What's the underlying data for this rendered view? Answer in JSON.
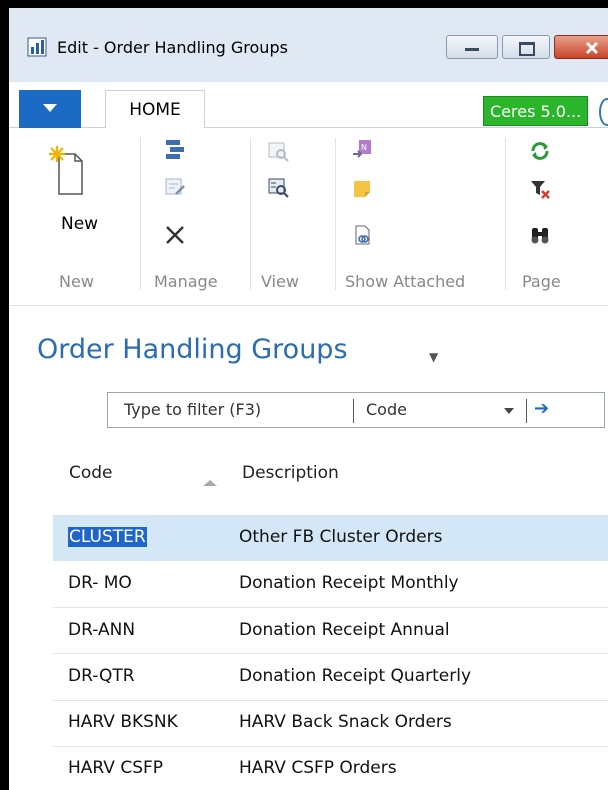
{
  "window": {
    "title": "Edit - Order Handling Groups"
  },
  "tabs": {
    "home": "HOME",
    "version": "Ceres 5.0..."
  },
  "ribbon": {
    "new_label": "New",
    "groups": [
      "New",
      "Manage",
      "View",
      "Show Attached",
      "Page"
    ]
  },
  "page": {
    "title": "Order Handling Groups"
  },
  "filter": {
    "placeholder": "Type to filter (F3)",
    "field": "Code"
  },
  "columns": [
    "Code",
    "Description"
  ],
  "rows": [
    {
      "code": "CLUSTER",
      "description": "Other FB Cluster Orders"
    },
    {
      "code": "DR- MO",
      "description": "Donation Receipt Monthly"
    },
    {
      "code": "DR-ANN",
      "description": "Donation Receipt Annual"
    },
    {
      "code": "DR-QTR",
      "description": "Donation Receipt Quarterly"
    },
    {
      "code": "HARV BKSNK",
      "description": "HARV Back Snack Orders"
    },
    {
      "code": "HARV CSFP",
      "description": "HARV CSFP Orders"
    }
  ],
  "colors": {
    "accent": "#1b6bc5",
    "selected_row": "#d4e7f7",
    "badge": "#2bb52b",
    "title": "#2a6db0"
  }
}
